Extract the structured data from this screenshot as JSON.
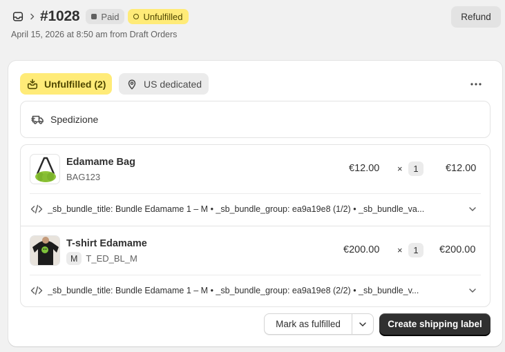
{
  "header": {
    "order_number": "#1028",
    "badges": {
      "payment": "Paid",
      "fulfillment": "Unfulfilled"
    },
    "subtitle": "April 15, 2026 at 8:50 am from Draft Orders",
    "refund_label": "Refund"
  },
  "card": {
    "status_tag": "Unfulfilled (2)",
    "location_tag": "US dedicated",
    "shipping_label": "Spedizione",
    "items": [
      {
        "name": "Edamame Bag",
        "sku": "BAG123",
        "variant": "",
        "price": "€12.00",
        "quantity": "1",
        "total": "€12.00",
        "properties": "_sb_bundle_title: Bundle Edamame 1 – M • _sb_bundle_group: ea9a19e8 (1/2) • _sb_bundle_va..."
      },
      {
        "name": "T-shirt Edamame",
        "sku": "T_ED_BL_M",
        "variant": "M",
        "price": "€200.00",
        "quantity": "1",
        "total": "€200.00",
        "properties": "_sb_bundle_title: Bundle Edamame 1 – M • _sb_bundle_group: ea9a19e8 (2/2) • _sb_bundle_v..."
      }
    ],
    "times_symbol": "×",
    "mark_fulfilled_label": "Mark as fulfilled",
    "create_label_button": "Create shipping label"
  },
  "icons": {
    "orders": "orders-inbox-icon",
    "breadcrumb": "chevron-right-icon",
    "fulfillment": "package-fulfill-icon",
    "location": "location-pin-icon",
    "more": "more-horizontal-icon",
    "shipping": "delivery-truck-icon",
    "properties": "code-icon",
    "expand": "chevron-down-icon"
  },
  "colors": {
    "unfulfilled_bg": "#ffeb78",
    "paid_bg": "#e3e3e3",
    "primary_button": "#303030"
  }
}
